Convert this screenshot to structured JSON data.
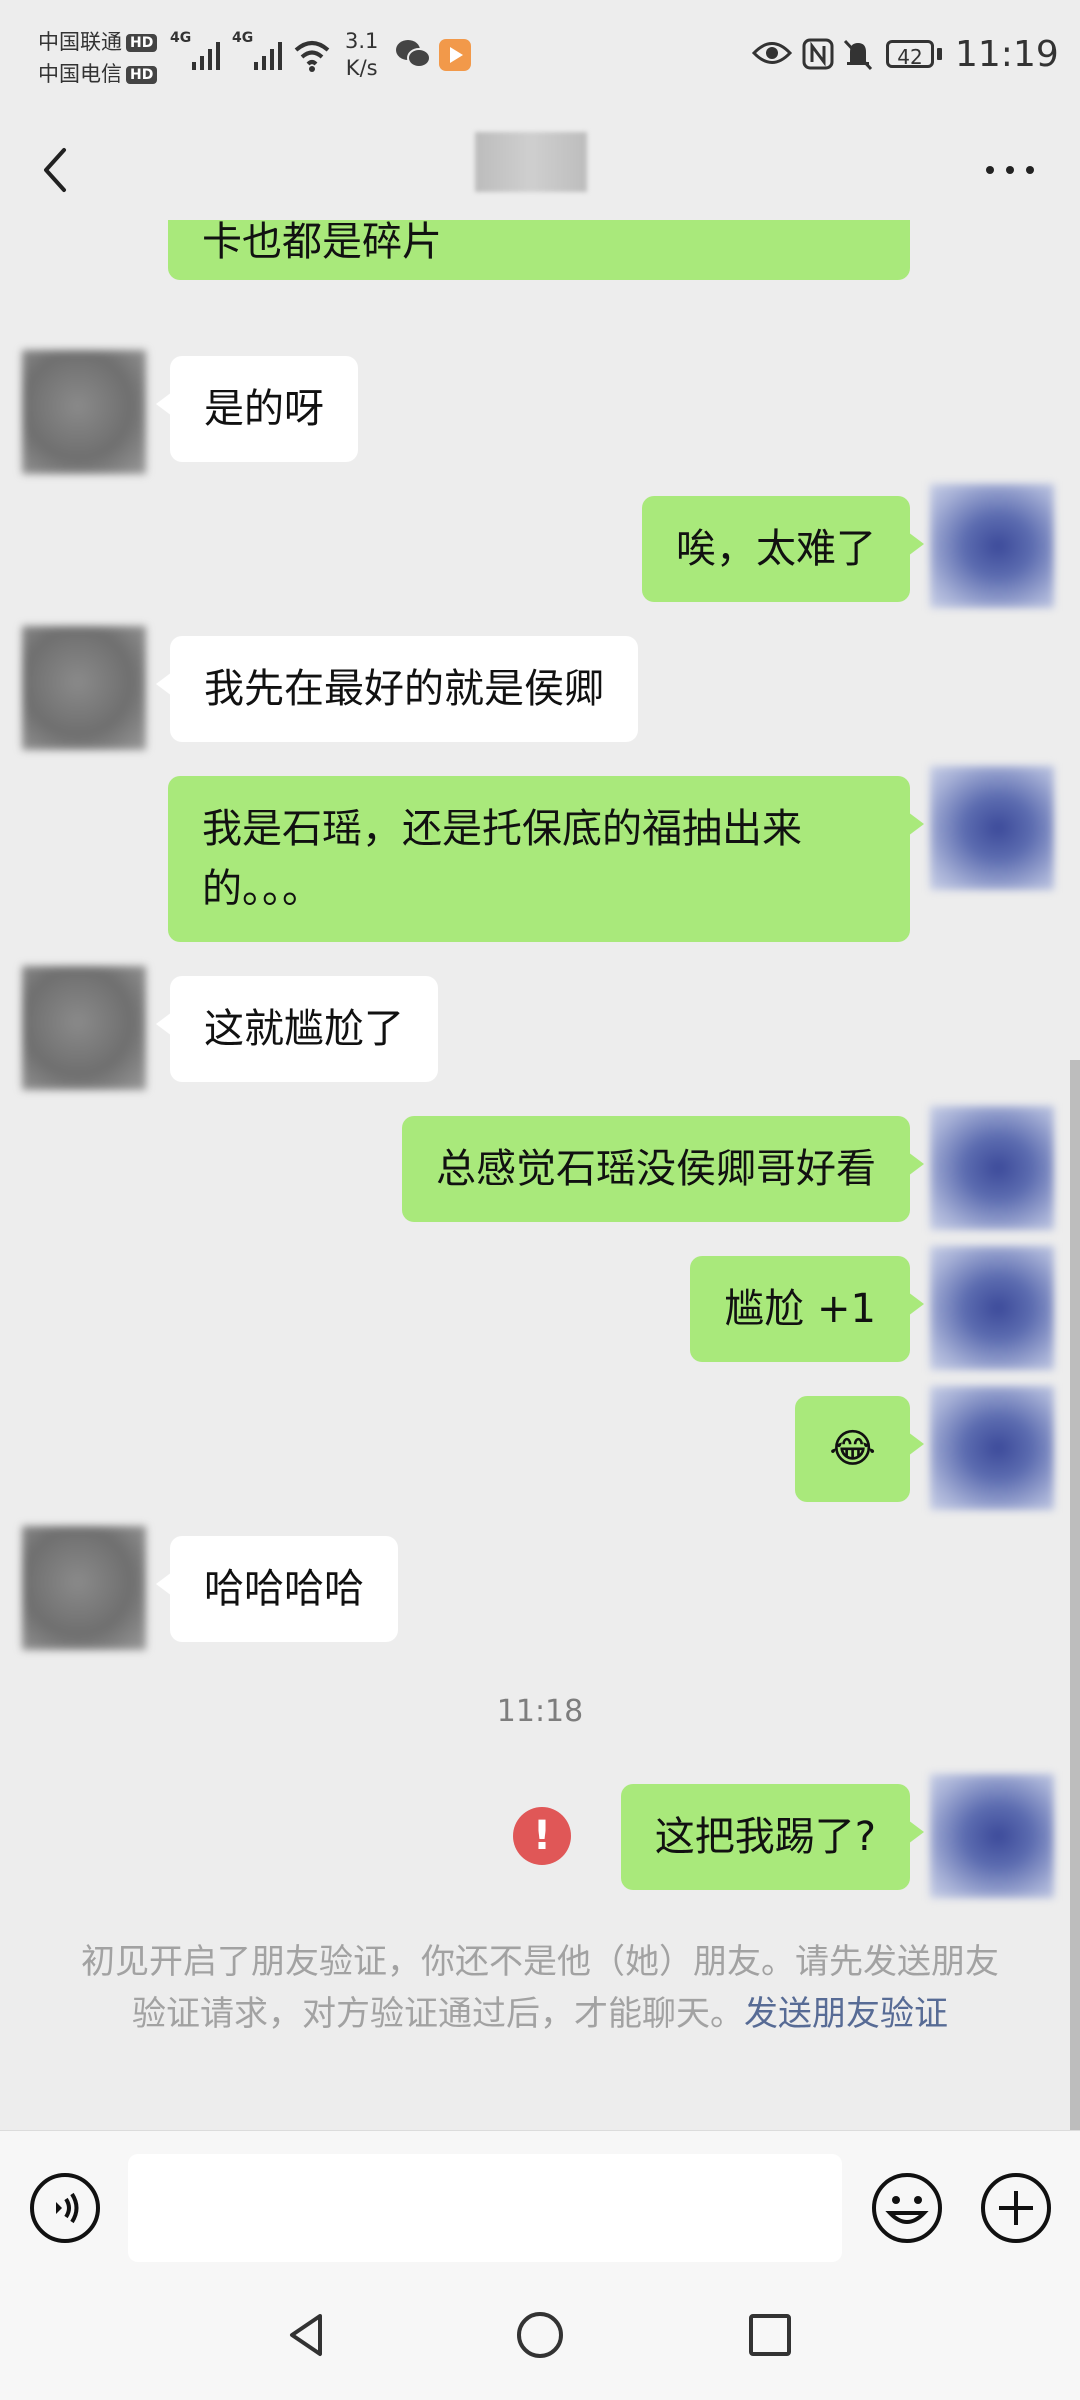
{
  "status_bar": {
    "carrier1": "中国联通",
    "carrier2": "中国电信",
    "hd_badge": "HD",
    "network1": "4G",
    "network2": "4G",
    "speed_value": "3.1",
    "speed_unit": "K/s",
    "battery": "42",
    "time": "11:19",
    "icons": [
      "wechat-icon",
      "video-app-icon",
      "eye-icon",
      "nfc-icon",
      "mute-bell-icon"
    ]
  },
  "header": {
    "back_icon": "chevron-left-icon",
    "more_icon": "more-dots-icon"
  },
  "messages": [
    {
      "from": "me",
      "text": "卡也都是碎片"
    },
    {
      "from": "them",
      "text": "是的呀"
    },
    {
      "from": "me",
      "text": "唉，太难了"
    },
    {
      "from": "them",
      "text": "我先在最好的就是侯卿"
    },
    {
      "from": "me",
      "text": "我是石瑶，还是托保底的福抽出来的。。。"
    },
    {
      "from": "them",
      "text": "这就尴尬了"
    },
    {
      "from": "me",
      "text": "总感觉石瑶没侯卿哥好看"
    },
    {
      "from": "me",
      "text": "尴尬 +1"
    },
    {
      "from": "me",
      "text": "😂",
      "type": "emoji"
    },
    {
      "from": "them",
      "text": "哈哈哈哈"
    },
    {
      "from": "me",
      "text": "这把我踢了?",
      "status": "failed"
    }
  ],
  "timestamp": "11:18",
  "system_note": {
    "text": "初见开启了朋友验证，你还不是他（她）朋友。请先发送朋友验证请求，对方验证通过后，才能聊天。",
    "link": "发送朋友验证"
  },
  "input_bar": {
    "value": "",
    "voice_icon": "voice-icon",
    "emoji_icon": "emoji-icon",
    "plus_icon": "plus-icon"
  },
  "colors": {
    "background": "#ededed",
    "my_bubble": "#a9e97b",
    "their_bubble": "#ffffff",
    "error": "#e05757",
    "link": "#576b95"
  }
}
